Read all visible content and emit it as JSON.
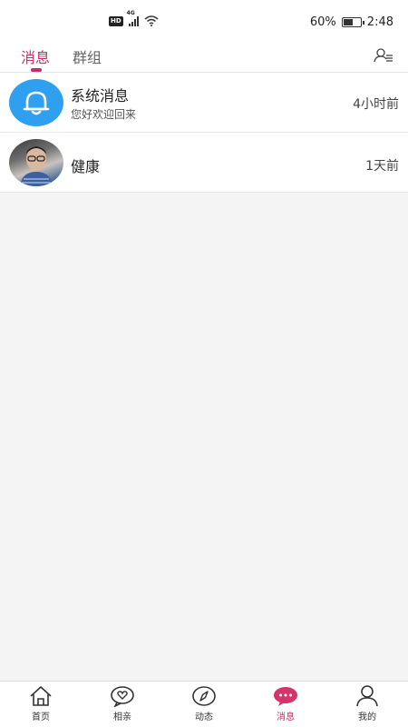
{
  "status_bar": {
    "network_badge": "HD",
    "network_type": "4G",
    "battery_percent": "60%",
    "battery_level": 0.6,
    "time": "2:48"
  },
  "tabs": [
    {
      "label": "消息",
      "active": true
    },
    {
      "label": "群组",
      "active": false
    }
  ],
  "conversations": [
    {
      "title": "系统消息",
      "subtitle": "您好欢迎回来",
      "time": "4小时前",
      "avatar_icon": "bell-icon"
    },
    {
      "title": "健康",
      "subtitle": "",
      "time": "1天前",
      "avatar_icon": "user-photo"
    }
  ],
  "bottom_nav": [
    {
      "label": "首页",
      "icon": "home-icon"
    },
    {
      "label": "相亲",
      "icon": "heart-chat-icon"
    },
    {
      "label": "动态",
      "icon": "compass-icon"
    },
    {
      "label": "消息",
      "icon": "chat-bubble-icon",
      "active": true
    },
    {
      "label": "我的",
      "icon": "person-icon"
    }
  ],
  "colors": {
    "accent": "#c0306a",
    "system_avatar": "#2f9ff0",
    "background": "#f4f4f4"
  }
}
